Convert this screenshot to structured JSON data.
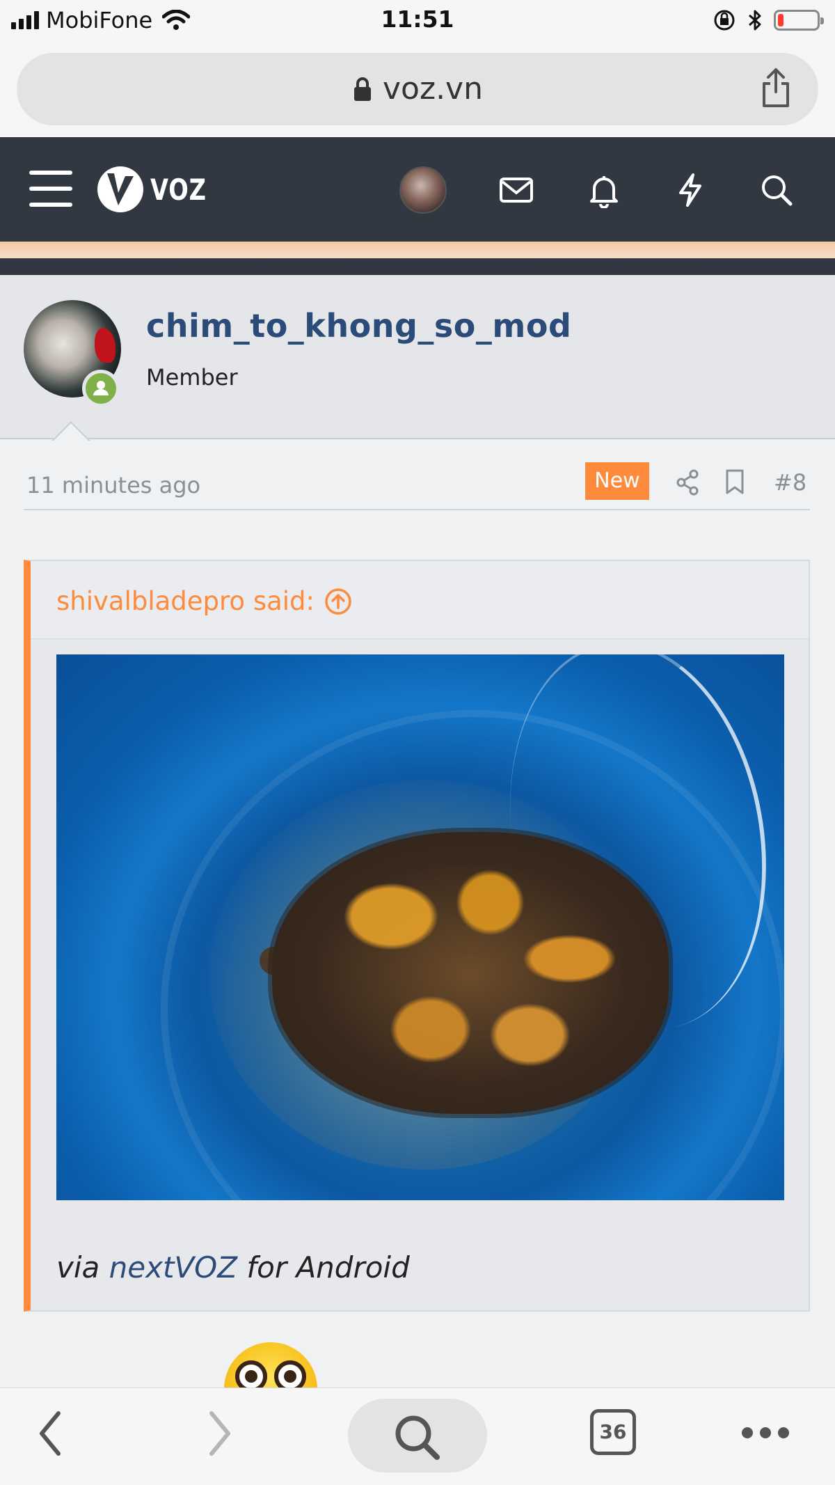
{
  "status_bar": {
    "carrier": "MobiFone",
    "time": "11:51",
    "battery_level_percent": 15
  },
  "browser": {
    "url": "voz.vn",
    "tab_count": "36"
  },
  "site": {
    "logo_text": "VOZ"
  },
  "post": {
    "username": "chim_to_khong_so_mod",
    "user_title": "Member",
    "time_ago": "11 minutes ago",
    "new_badge": "New",
    "post_number": "#8",
    "quote": {
      "author": "shivalbladepro said:",
      "via_prefix": "via",
      "via_link": "nextVOZ",
      "via_suffix": "for Android"
    }
  },
  "colors": {
    "accent": "#fe8a3c",
    "nav_bg": "#323841",
    "username": "#2b4b78",
    "online": "#7fb04a"
  }
}
